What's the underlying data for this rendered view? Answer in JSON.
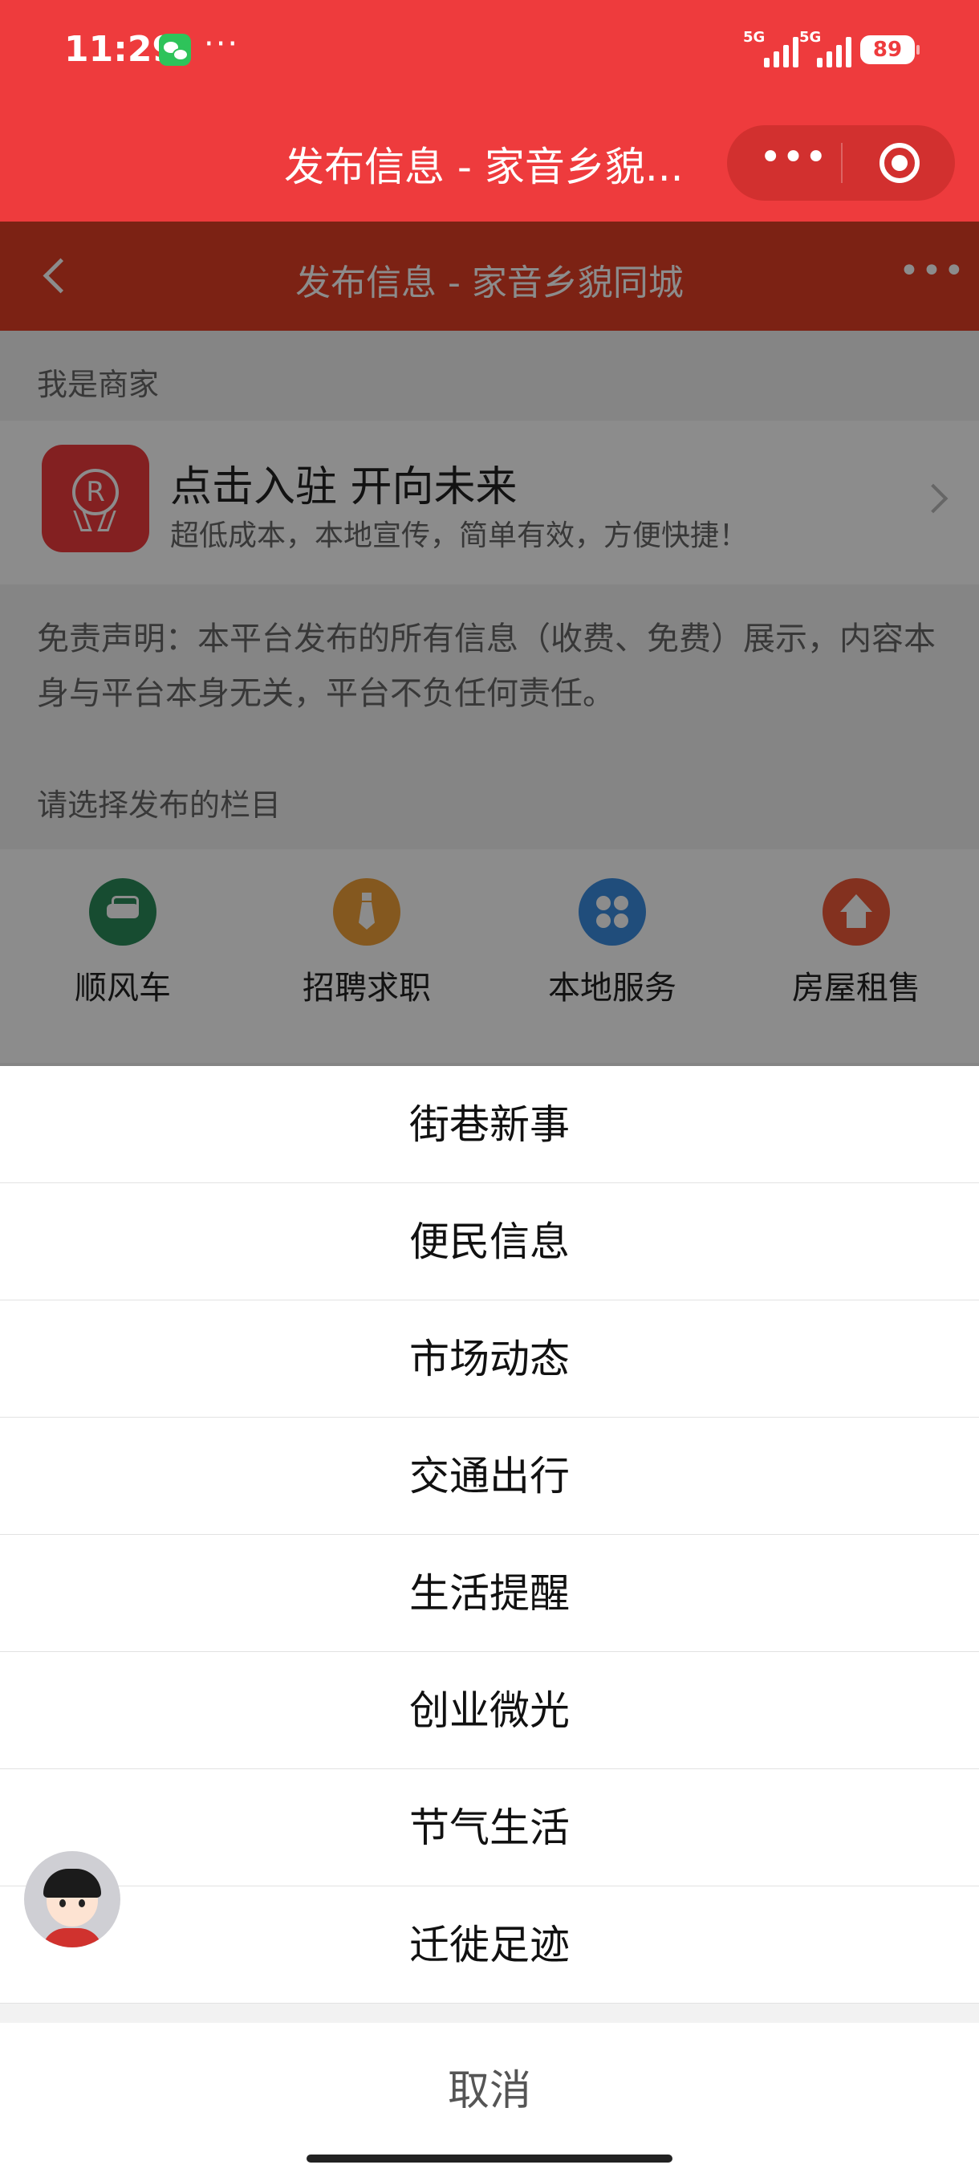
{
  "status_bar": {
    "time": "11:29",
    "dots": "···",
    "signal1": "5G",
    "signal2": "5G",
    "battery": "89"
  },
  "miniprogram": {
    "title": "发布信息 - 家音乡貌...",
    "more_icon": "more-dots-icon",
    "close_icon": "target-close-icon"
  },
  "nav": {
    "title": "发布信息 - 家音乡貌同城",
    "back_icon": "chevron-left-icon",
    "more_icon": "more-dots-icon"
  },
  "merchant": {
    "section_label": "我是商家",
    "title": "点击入驻 开向未来",
    "subtitle": "超低成本，本地宣传，简单有效，方便快捷！",
    "icon": "registered-badge-icon"
  },
  "disclaimer": "免责声明：本平台发布的所有信息（收费、免费）展示，内容本身与平台本身无关，平台不负任何责任。",
  "categories": {
    "section_label": "请选择发布的栏目",
    "items": [
      {
        "label": "顺风车",
        "icon": "car-icon",
        "color": "#2a8a5a"
      },
      {
        "label": "招聘求职",
        "icon": "tie-icon",
        "color": "#f0a13a"
      },
      {
        "label": "本地服务",
        "icon": "clover-icon",
        "color": "#3b8de0"
      },
      {
        "label": "房屋租售",
        "icon": "house-icon",
        "color": "#ee5a3a"
      }
    ]
  },
  "action_sheet": {
    "items": [
      "街巷新事",
      "便民信息",
      "市场动态",
      "交通出行",
      "生活提醒",
      "创业微光",
      "节气生活",
      "迁徙足迹"
    ],
    "cancel": "取消"
  },
  "colors": {
    "brand_red": "#ee3b3d",
    "nav_red": "#e23e26"
  }
}
